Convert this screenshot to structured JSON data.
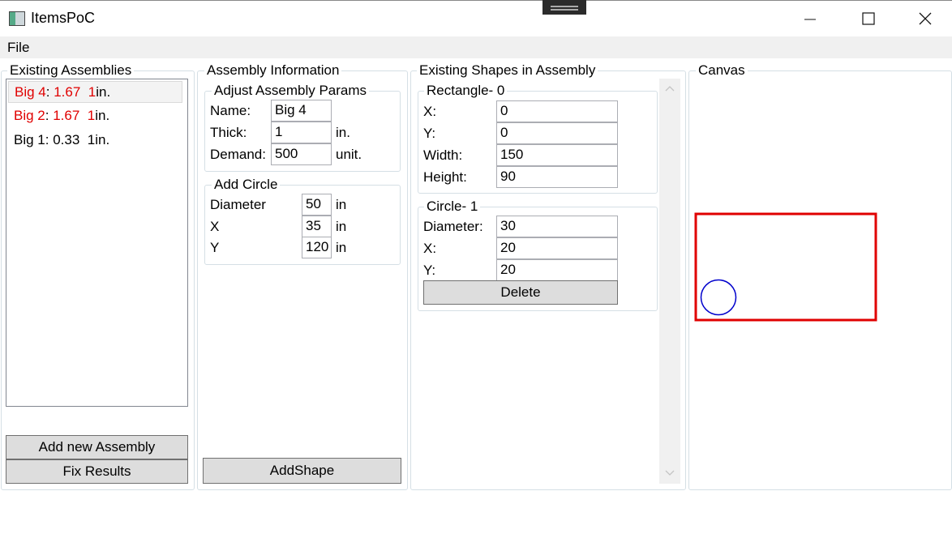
{
  "window": {
    "title": "ItemsPoC",
    "minimize_icon": "minimize-icon",
    "maximize_icon": "maximize-icon",
    "close_icon": "close-icon"
  },
  "menu": {
    "file": "File"
  },
  "assemblies": {
    "legend": "Existing Assemblies",
    "items": [
      {
        "name": "Big 4",
        "sep": ":",
        "value": "1.67",
        "thick": "1",
        "unit": "in.",
        "red": true,
        "selected": true
      },
      {
        "name": "Big 2",
        "sep": ":",
        "value": "1.67",
        "thick": "1",
        "unit": "in.",
        "red": true,
        "selected": false
      },
      {
        "name": "Big 1",
        "sep": ":",
        "value": "0.33",
        "thick": "1",
        "unit": "in.",
        "red": false,
        "selected": false
      }
    ],
    "add_button": "Add new Assembly",
    "fix_button": "Fix Results"
  },
  "info": {
    "legend": "Assembly Information",
    "params": {
      "legend": "Adjust Assembly Params",
      "name_label": "Name:",
      "name_value": "Big 4",
      "thick_label": "Thick:",
      "thick_value": "1",
      "thick_unit": "in.",
      "demand_label": "Demand:",
      "demand_value": "500",
      "demand_unit": "unit."
    },
    "circle": {
      "legend": "Add Circle",
      "diameter_label": "Diameter",
      "diameter_value": "50",
      "diameter_unit": "in",
      "x_label": "X",
      "x_value": "35",
      "x_unit": "in",
      "y_label": "Y",
      "y_value": "120",
      "y_unit": "in"
    },
    "add_shape_button": "AddShape"
  },
  "shapes": {
    "legend": "Existing Shapes in Assembly",
    "rectangle": {
      "legend": "Rectangle- 0",
      "x_label": "X:",
      "x_value": "0",
      "y_label": "Y:",
      "y_value": "0",
      "width_label": "Width:",
      "width_value": "150",
      "height_label": "Height:",
      "height_value": "90"
    },
    "circle": {
      "legend": "Circle- 1",
      "diameter_label": "Diameter:",
      "diameter_value": "30",
      "x_label": "X:",
      "x_value": "20",
      "y_label": "Y:",
      "y_value": "20",
      "delete_button": "Delete"
    }
  },
  "canvas": {
    "legend": "Canvas",
    "rect_color": "#e00000",
    "circle_color": "#0000cc"
  }
}
